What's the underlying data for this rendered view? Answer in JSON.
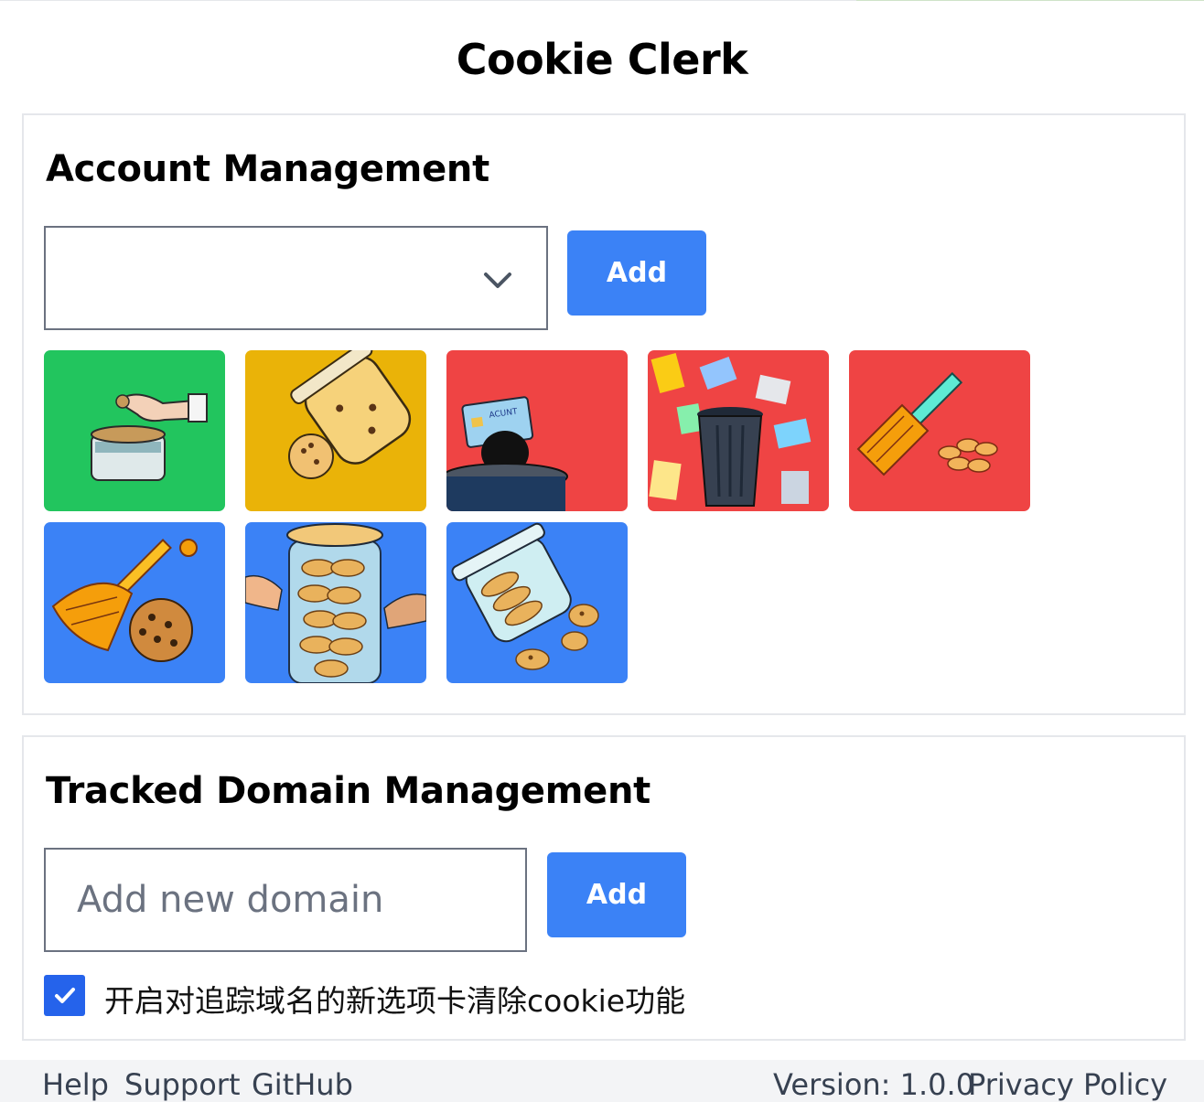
{
  "app": {
    "title": "Cookie Clerk"
  },
  "account_section": {
    "title": "Account Management",
    "select_value": "",
    "add_label": "Add",
    "tiles": [
      {
        "icon": "cookie-jar-hand-icon",
        "color": "#22c55e"
      },
      {
        "icon": "spilled-cookie-jar-icon",
        "color": "#eab308"
      },
      {
        "icon": "account-card-bin-icon",
        "color": "#ef4444"
      },
      {
        "icon": "cards-trash-can-icon",
        "color": "#ef4444"
      },
      {
        "icon": "broom-cookies-icon",
        "color": "#ef4444"
      },
      {
        "icon": "broom-cookie-icon",
        "color": "#3b82f6"
      },
      {
        "icon": "full-cookie-jar-icon",
        "color": "#3b82f6"
      },
      {
        "icon": "tipped-cookie-jar-icon",
        "color": "#3b82f6"
      }
    ]
  },
  "domain_section": {
    "title": "Tracked Domain Management",
    "input_placeholder": "Add new domain",
    "add_label": "Add",
    "checkbox_checked": true,
    "checkbox_label": "开启对追踪域名的新选项卡清除cookie功能"
  },
  "footer": {
    "links": [
      "Help",
      "Support",
      "GitHub"
    ],
    "version": "Version: 1.0.0",
    "privacy": "Privacy Policy"
  },
  "colors": {
    "primary": "#3b82f6",
    "checkbox": "#2563eb",
    "border": "#6b7280"
  }
}
